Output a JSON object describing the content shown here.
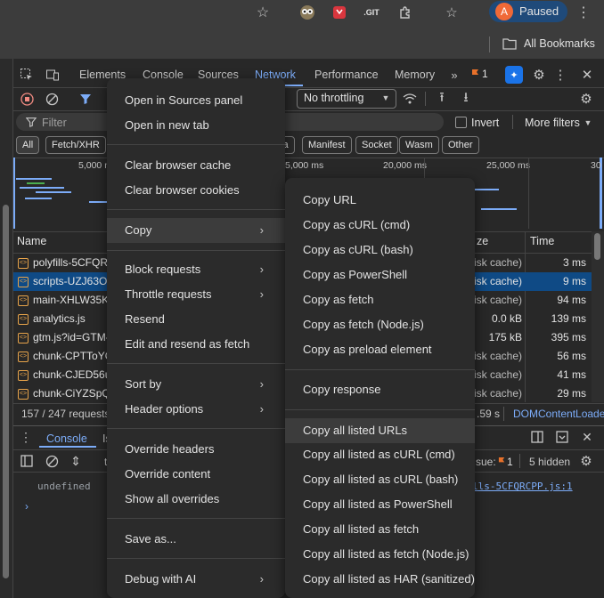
{
  "browser": {
    "profile_initial": "A",
    "profile_status": "Paused",
    "bookmarks_label": "All Bookmarks",
    "ext_git_label": ".GIT"
  },
  "devtools": {
    "tabs": [
      "Elements",
      "Console",
      "Sources",
      "Network",
      "Performance",
      "Memory"
    ],
    "issues_count": "1",
    "throttling": "No throttling",
    "filter_placeholder": "Filter",
    "invert_label": "Invert",
    "more_filters": "More filters",
    "type_chips": [
      "All",
      "Fetch/XHR",
      "ia",
      "Manifest",
      "Socket",
      "Wasm",
      "Other"
    ],
    "timeline_ticks": [
      "5,000 m",
      "5,000 ms",
      "20,000 ms",
      "25,000 ms",
      "30"
    ],
    "columns": {
      "name": "Name",
      "size": "ze",
      "time": "Time"
    },
    "rows": [
      {
        "name": "polyfills-5CFQRC",
        "size": "lisk cache)",
        "time": "3 ms"
      },
      {
        "name": "scripts-UZJ63OC",
        "size": "lisk cache)",
        "time": "9 ms"
      },
      {
        "name": "main-XHLW35K",
        "size": "lisk cache)",
        "time": "94 ms"
      },
      {
        "name": "analytics.js",
        "size": "0.0 kB",
        "time": "139 ms"
      },
      {
        "name": "gtm.js?id=GTM-",
        "size": "175 kB",
        "time": "395 ms"
      },
      {
        "name": "chunk-CPTToYO",
        "size": "lisk cache)",
        "time": "56 ms"
      },
      {
        "name": "chunk-CJED56u",
        "size": "lisk cache)",
        "time": "41 ms"
      },
      {
        "name": "chunk-CiYZSpQ",
        "size": "lisk cache)",
        "time": "29 ms"
      }
    ],
    "status_requests": "157 / 247 requests",
    "status_finish": ".59 s",
    "status_dcl": "DOMContentLoade",
    "drawer_tab": "Console",
    "drawer_tab2": "Is",
    "console_issues_label": "sue:",
    "console_issues_count": "1",
    "console_hidden": "5 hidden",
    "console_undefined": "undefined",
    "console_link": "lls-5CFQRCPP.js:1",
    "console_t": "t"
  },
  "context_menu": {
    "items": [
      "Open in Sources panel",
      "Open in new tab",
      "Clear browser cache",
      "Clear browser cookies",
      "Copy",
      "Block requests",
      "Throttle requests",
      "Resend",
      "Edit and resend as fetch",
      "Sort by",
      "Header options",
      "Override headers",
      "Override content",
      "Show all overrides",
      "Save as...",
      "Debug with AI"
    ]
  },
  "copy_submenu": {
    "items": [
      "Copy URL",
      "Copy as cURL (cmd)",
      "Copy as cURL (bash)",
      "Copy as PowerShell",
      "Copy as fetch",
      "Copy as fetch (Node.js)",
      "Copy as preload element",
      "Copy response",
      "Copy all listed URLs",
      "Copy all listed as cURL (cmd)",
      "Copy all listed as cURL (bash)",
      "Copy all listed as PowerShell",
      "Copy all listed as fetch",
      "Copy all listed as fetch (Node.js)",
      "Copy all listed as HAR (sanitized)"
    ]
  },
  "colors": {
    "accent_blue": "#7cacf8",
    "selected_row": "#0f4a85",
    "record_red": "#f28b82",
    "profile_bg": "#1f4a7a",
    "avatar": "#f06937"
  }
}
